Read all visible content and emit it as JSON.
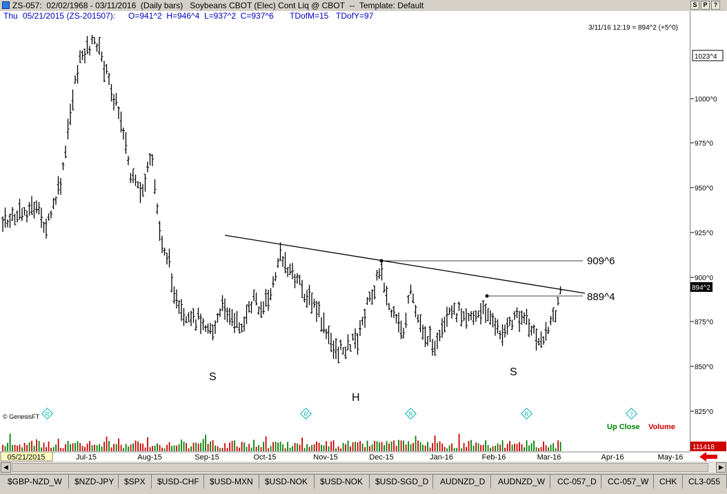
{
  "window": {
    "title": "ZS-057:  02/02/1968 - 03/11/2016  (Daily bars)   Soybeans CBOT (Elec) Cont Liq @ CBOT  --  Template: Default",
    "buttons": [
      "S",
      "P",
      "?"
    ]
  },
  "info_bar": {
    "day": "Thu",
    "date_contract": "05/21/2015 (ZS-201507):",
    "ohlc": "O=941^2  H=946^4  L=937^2  C=937^6",
    "tdofm": "TDofM=15",
    "tdofy": "TDofY=97"
  },
  "timestamp_label": "3/11/16 12:19 = 894^2 (+5^0)",
  "copyright": "© GenesisFT",
  "legend": {
    "up_close": "Up Close",
    "volume": "Volume",
    "up_color": "#008000",
    "down_color": "#cc0000"
  },
  "y_axis": {
    "top_box": "1023^4",
    "last_price_box": "894^2",
    "volume_box": "111418",
    "ticks": [
      "1000^0",
      "975^0",
      "950^0",
      "925^0",
      "900^0",
      "875^0",
      "850^0",
      "825^0"
    ]
  },
  "x_axis": {
    "cursor_date": "05/21/2015",
    "months": [
      "Jul-15",
      "Aug-15",
      "Sep-15",
      "Oct-15",
      "Nov-15",
      "Dec-15",
      "Jan-16",
      "Feb-16",
      "Mar-16",
      "Apr-16",
      "May-16"
    ]
  },
  "annotations": {
    "shoulder_left": "S",
    "head": "H",
    "shoulder_right": "S",
    "level_high": "909^6",
    "level_low": "889^4"
  },
  "tabs": [
    "$GBP-NZD_W",
    "$NZD-JPY",
    "$SPX",
    "$USD-CHF",
    "$USD-MXN",
    "$USD-NOK",
    "$USD-NOK",
    "$USD-SGD_D",
    "AUDNZD_D",
    "AUDNZD_W",
    "CC-057_D",
    "CC-057_W",
    "CHK",
    "CL3-055"
  ],
  "colors": {
    "price_bar": "#000000",
    "up_volume": "#008000",
    "down_volume": "#cc0000",
    "marker": "#00c0c0",
    "info_text": "#0000c0"
  }
}
